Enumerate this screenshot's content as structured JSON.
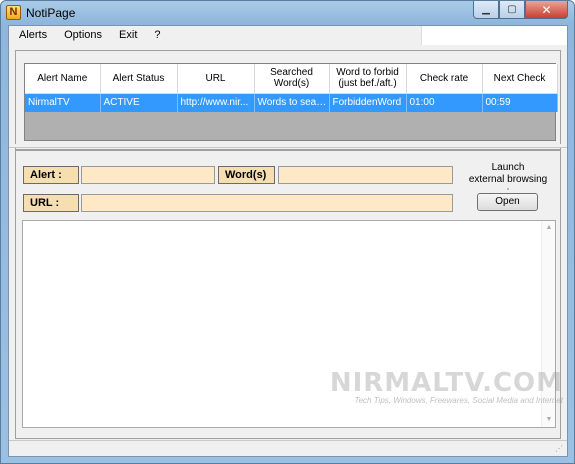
{
  "window": {
    "title": "NotiPage",
    "icon_letter": "N",
    "controls": {
      "minimize": "▁",
      "maximize": "▢",
      "close": "✕"
    }
  },
  "menu": [
    "Alerts",
    "Options",
    "Exit",
    "?"
  ],
  "grid": {
    "columns": [
      "Alert Name",
      "Alert Status",
      "URL",
      "Searched Word(s)",
      "Word to forbid (just bef./aft.)",
      "Check rate",
      "Next Check"
    ],
    "rows": [
      [
        "NirmalTV",
        "ACTIVE",
        "http://www.nir...",
        "Words to searc...",
        "ForbiddenWord",
        "01:00",
        "00:59"
      ]
    ],
    "selected_color": "#3399ff"
  },
  "form": {
    "alert_label": "Alert :",
    "alert_value": "",
    "words_label": "Word(s)",
    "words_value": "",
    "url_label": "URL :",
    "url_value": "",
    "launch_text_1": "Launch",
    "launch_text_2": "external browsing :",
    "open_button": "Open"
  },
  "watermark": {
    "main": "NIRMALTV.COM",
    "sub": "Tech Tips, Windows, Freewares, Social Media and Internet"
  },
  "colors": {
    "label_bg": "#f5dfb0",
    "field_bg": "#fde9c6"
  }
}
